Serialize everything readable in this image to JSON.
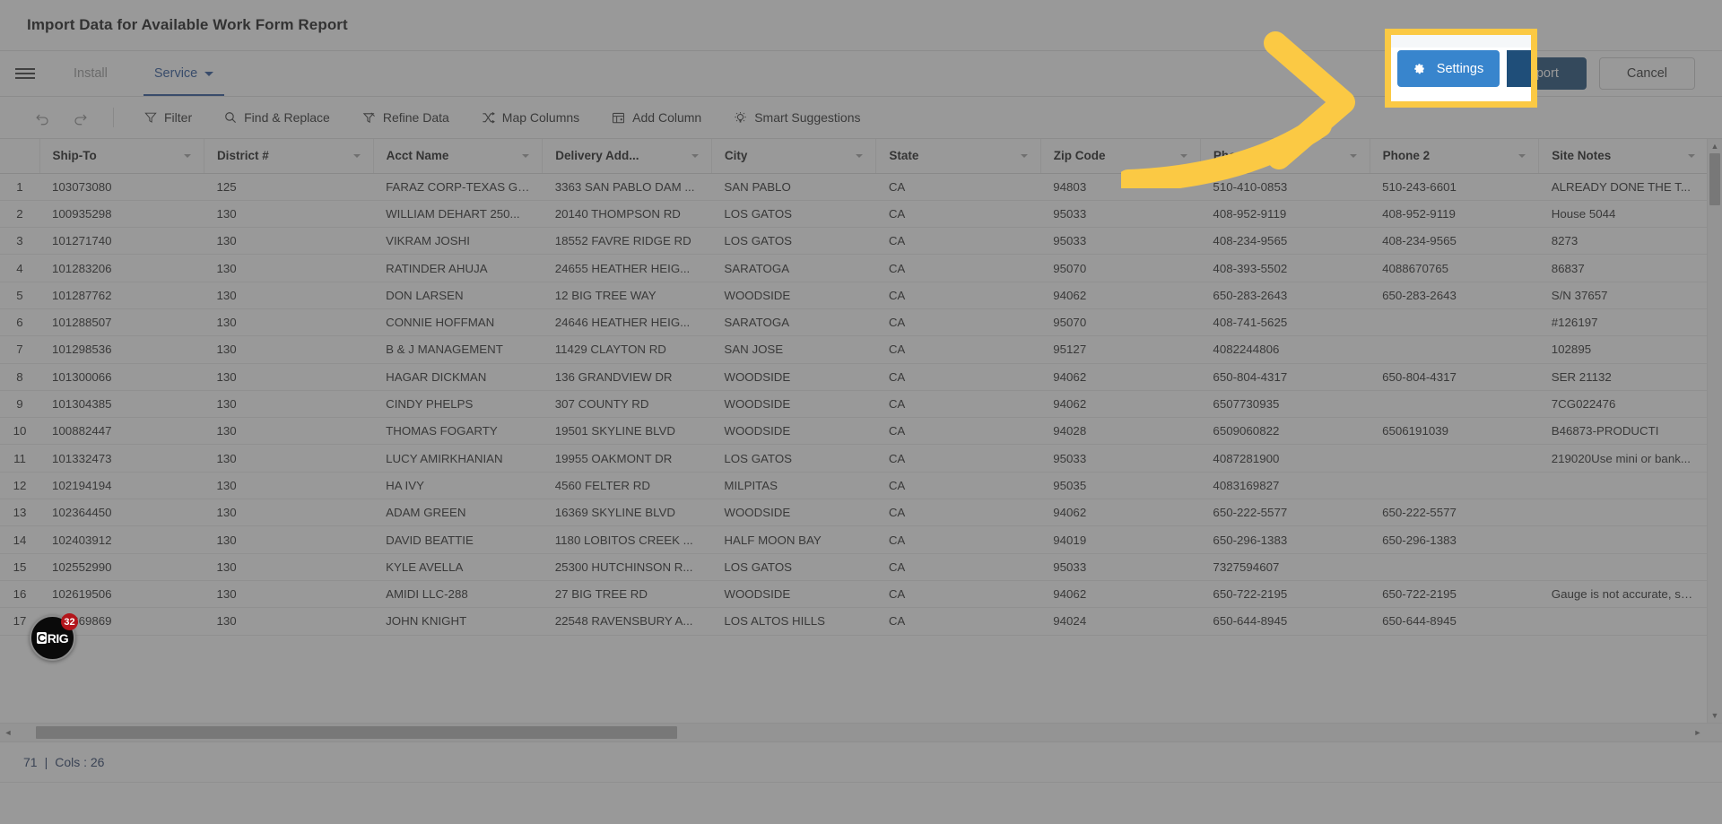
{
  "window": {
    "title": "Import Data for Available Work Form Report"
  },
  "tabs": {
    "menu_icon": "hamburger-menu-icon",
    "items": [
      {
        "label": "Install",
        "active": false,
        "has_caret": false
      },
      {
        "label": "Service",
        "active": true,
        "has_caret": true
      }
    ]
  },
  "actions": {
    "settings_label": "Settings",
    "settings_icon": "gear-icon",
    "import_label": "Import",
    "cancel_label": "Cancel"
  },
  "toolbar": {
    "undo_icon": "undo-arrow-icon",
    "redo_icon": "redo-arrow-icon",
    "items": [
      {
        "label": "Filter",
        "icon": "funnel-icon"
      },
      {
        "label": "Find & Replace",
        "icon": "magnifier-icon"
      },
      {
        "label": "Refine Data",
        "icon": "refine-data-icon"
      },
      {
        "label": "Map Columns",
        "icon": "map-columns-icon"
      },
      {
        "label": "Add Column",
        "icon": "add-column-icon"
      },
      {
        "label": "Smart Suggestions",
        "icon": "lightbulb-icon"
      }
    ]
  },
  "grid": {
    "columns": [
      "Ship-To",
      "District #",
      "Acct Name",
      "Delivery Add...",
      "City",
      "State",
      "Zip Code",
      "Phone 1",
      "Phone 2",
      "Site Notes"
    ],
    "rows": [
      {
        "n": "1",
        "cells": [
          "103073080",
          "125",
          "FARAZ CORP-TEXAS GAS",
          "3363 SAN PABLO DAM ...",
          "SAN PABLO",
          "CA",
          "94803",
          "510-410-0853",
          "510-243-6601",
          "ALREADY DONE THE T..."
        ]
      },
      {
        "n": "2",
        "cells": [
          "100935298",
          "130",
          "WILLIAM DEHART 250...",
          "20140 THOMPSON RD",
          "LOS GATOS",
          "CA",
          "95033",
          "408-952-9119",
          "408-952-9119",
          "House 5044"
        ]
      },
      {
        "n": "3",
        "cells": [
          "101271740",
          "130",
          "VIKRAM JOSHI",
          "18552 FAVRE RIDGE RD",
          "LOS GATOS",
          "CA",
          "95033",
          "408-234-9565",
          "408-234-9565",
          "8273"
        ]
      },
      {
        "n": "4",
        "cells": [
          "101283206",
          "130",
          "RATINDER AHUJA",
          "24655 HEATHER HEIG...",
          "SARATOGA",
          "CA",
          "95070",
          "408-393-5502",
          "4088670765",
          "86837"
        ]
      },
      {
        "n": "5",
        "cells": [
          "101287762",
          "130",
          "DON LARSEN",
          "12 BIG TREE WAY",
          "WOODSIDE",
          "CA",
          "94062",
          "650-283-2643",
          "650-283-2643",
          "S/N 37657"
        ]
      },
      {
        "n": "6",
        "cells": [
          "101288507",
          "130",
          "CONNIE HOFFMAN",
          "24646 HEATHER HEIG...",
          "SARATOGA",
          "CA",
          "95070",
          "408-741-5625",
          "",
          "#126197"
        ]
      },
      {
        "n": "7",
        "cells": [
          "101298536",
          "130",
          "B & J MANAGEMENT",
          "11429 CLAYTON RD",
          "SAN JOSE",
          "CA",
          "95127",
          "4082244806",
          "",
          "102895"
        ]
      },
      {
        "n": "8",
        "cells": [
          "101300066",
          "130",
          "HAGAR DICKMAN",
          "136 GRANDVIEW DR",
          "WOODSIDE",
          "CA",
          "94062",
          "650-804-4317",
          "650-804-4317",
          "SER 21132"
        ]
      },
      {
        "n": "9",
        "cells": [
          "101304385",
          "130",
          "CINDY PHELPS",
          "307 COUNTY RD",
          "WOODSIDE",
          "CA",
          "94062",
          "6507730935",
          "",
          "7CG022476"
        ]
      },
      {
        "n": "10",
        "cells": [
          "100882447",
          "130",
          "THOMAS FOGARTY",
          "19501 SKYLINE BLVD",
          "WOODSIDE",
          "CA",
          "94028",
          "6509060822",
          "6506191039",
          "B46873-PRODUCTI"
        ]
      },
      {
        "n": "11",
        "cells": [
          "101332473",
          "130",
          "LUCY AMIRKHANIAN",
          "19955 OAKMONT DR",
          "LOS GATOS",
          "CA",
          "95033",
          "4087281900",
          "",
          "219020Use mini or bank..."
        ]
      },
      {
        "n": "12",
        "cells": [
          "102194194",
          "130",
          "HA IVY",
          "4560 FELTER RD",
          "MILPITAS",
          "CA",
          "95035",
          "4083169827",
          "",
          ""
        ]
      },
      {
        "n": "13",
        "cells": [
          "102364450",
          "130",
          "ADAM GREEN",
          "16369 SKYLINE BLVD",
          "WOODSIDE",
          "CA",
          "94062",
          "650-222-5577",
          "650-222-5577",
          ""
        ]
      },
      {
        "n": "14",
        "cells": [
          "102403912",
          "130",
          "DAVID BEATTIE",
          "1180 LOBITOS CREEK ...",
          "HALF MOON BAY",
          "CA",
          "94019",
          "650-296-1383",
          "650-296-1383",
          ""
        ]
      },
      {
        "n": "15",
        "cells": [
          "102552990",
          "130",
          "KYLE AVELLA",
          "25300 HUTCHINSON R...",
          "LOS GATOS",
          "CA",
          "95033",
          "7327594607",
          "",
          ""
        ]
      },
      {
        "n": "16",
        "cells": [
          "102619506",
          "130",
          "AMIDI LLC-288",
          "27 BIG TREE RD",
          "WOODSIDE",
          "CA",
          "94062",
          "650-722-2195",
          "650-722-2195",
          "Gauge is not accurate, sp..."
        ]
      },
      {
        "n": "17",
        "cells": [
          "102669869",
          "130",
          "JOHN KNIGHT",
          "22548 RAVENSBURY A...",
          "LOS ALTOS HILLS",
          "CA",
          "94024",
          "650-644-8945",
          "650-644-8945",
          ""
        ]
      }
    ]
  },
  "status": {
    "rows_text": "71",
    "separator": "|",
    "cols_text": "Cols : 26"
  },
  "widget": {
    "logo_c": "C",
    "logo_rest": "RIG",
    "badge_count": "32"
  },
  "annotation": {
    "arrow_color": "#fbc944",
    "highlight_color": "#fbc944",
    "target": "Settings"
  }
}
